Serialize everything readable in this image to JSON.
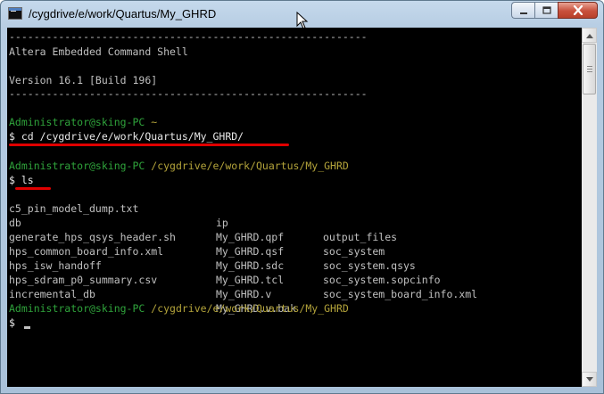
{
  "window": {
    "title": "/cygdrive/e/work/Quartus/My_GHRD"
  },
  "console": {
    "separator_top": "----------------------------------------------------------",
    "heading": "Altera Embedded Command Shell",
    "version": "Version 16.1 [Build 196]",
    "separator_bottom": "----------------------------------------------------------",
    "prompt1_user": "Administrator@sking-PC",
    "prompt1_path": "~",
    "cmd1": "$ cd /cygdrive/e/work/Quartus/My_GHRD/",
    "prompt2_user": "Administrator@sking-PC",
    "prompt2_path": "/cygdrive/e/work/Quartus/My_GHRD",
    "cmd2": "$ ls",
    "listing": [
      [
        "c5_pin_model_dump.txt",
        "ip",
        "output_files"
      ],
      [
        "db",
        "My_GHRD.qpf",
        "soc_system"
      ],
      [
        "generate_hps_qsys_header.sh",
        "My_GHRD.qsf",
        "soc_system.qsys"
      ],
      [
        "hps_common_board_info.xml",
        "My_GHRD.sdc",
        "soc_system.sopcinfo"
      ],
      [
        "hps_isw_handoff",
        "My_GHRD.tcl",
        "soc_system_board_info.xml"
      ],
      [
        "hps_sdram_p0_summary.csv",
        "My_GHRD.v",
        ""
      ],
      [
        "incremental_db",
        "My_GHRD.v.bak",
        ""
      ]
    ],
    "prompt3_user": "Administrator@sking-PC",
    "prompt3_path": "/cygdrive/e/work/Quartus/My_GHRD",
    "prompt3_symbol": "$"
  },
  "colors": {
    "prompt_user": "#2fa33b",
    "prompt_path": "#b3a33a",
    "annotation": "#e00000"
  }
}
